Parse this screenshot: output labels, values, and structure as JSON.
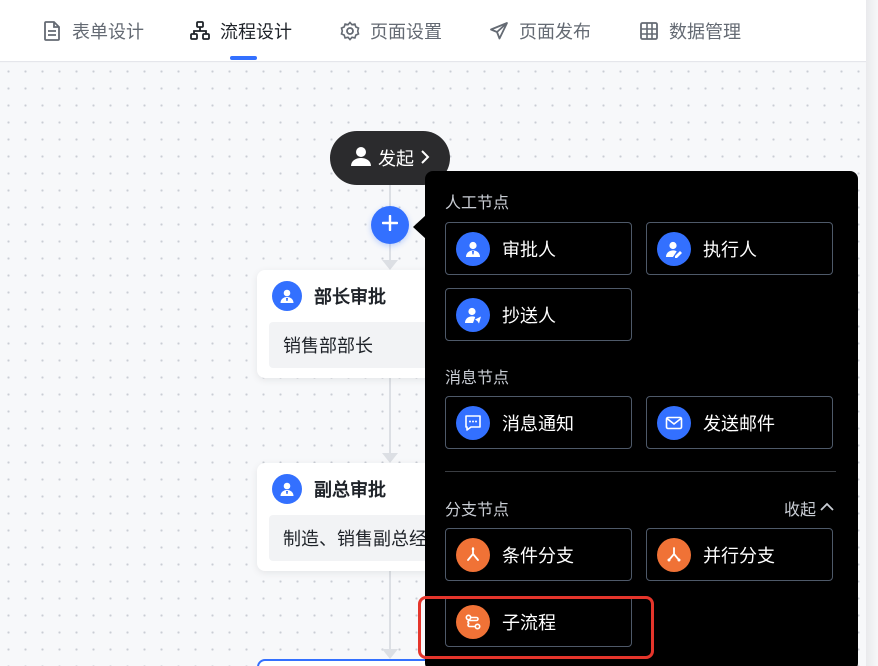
{
  "tabs": [
    {
      "label": "表单设计",
      "icon": "document-icon"
    },
    {
      "label": "流程设计",
      "icon": "org-chart-icon",
      "active": true
    },
    {
      "label": "页面设置",
      "icon": "gear-icon"
    },
    {
      "label": "页面发布",
      "icon": "send-icon"
    },
    {
      "label": "数据管理",
      "icon": "table-icon"
    }
  ],
  "flow": {
    "start_label": "发起",
    "nodes": [
      {
        "title": "部长审批",
        "detail": "销售部部长"
      },
      {
        "title": "副总审批",
        "detail": "制造、销售副总经理"
      }
    ]
  },
  "menu": {
    "sections": [
      {
        "title": "人工节点",
        "items": [
          {
            "label": "审批人",
            "icon": "approver-icon"
          },
          {
            "label": "执行人",
            "icon": "executor-icon"
          },
          {
            "label": "抄送人",
            "icon": "cc-icon"
          }
        ]
      },
      {
        "title": "消息节点",
        "items": [
          {
            "label": "消息通知",
            "icon": "message-icon"
          },
          {
            "label": "发送邮件",
            "icon": "mail-icon"
          }
        ]
      },
      {
        "title": "分支节点",
        "collapse_label": "收起",
        "items": [
          {
            "label": "条件分支",
            "icon": "branch-icon"
          },
          {
            "label": "并行分支",
            "icon": "parallel-branch-icon"
          },
          {
            "label": "子流程",
            "icon": "subprocess-icon"
          }
        ]
      }
    ]
  },
  "colors": {
    "accent": "#3370ff",
    "orange": "#f07236",
    "highlight": "#e5352b"
  }
}
